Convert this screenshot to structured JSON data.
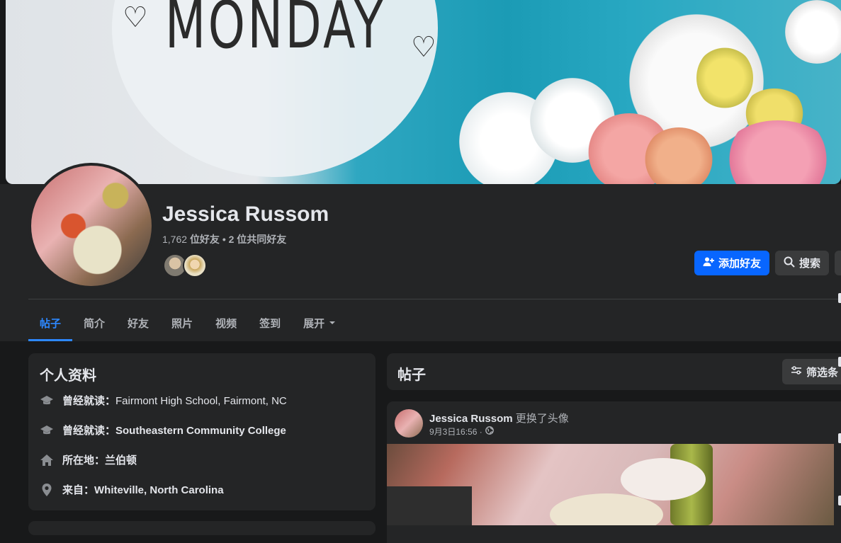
{
  "cover": {
    "text": "MONDAY"
  },
  "profile": {
    "name": "Jessica Russom",
    "friends_count": "1,762",
    "friends_suffix": "位好友",
    "mutual_text": "• 2 位共同好友"
  },
  "actions": {
    "add_friend": "添加好友",
    "search": "搜索"
  },
  "tabs": [
    {
      "label": "帖子"
    },
    {
      "label": "简介"
    },
    {
      "label": "好友"
    },
    {
      "label": "照片"
    },
    {
      "label": "视频"
    },
    {
      "label": "签到"
    },
    {
      "label": "展开"
    }
  ],
  "intro": {
    "title": "个人资料",
    "items": [
      {
        "prefix": "曾经就读：",
        "value": "Fairmont High School, Fairmont, NC",
        "icon": "graduation-cap-icon"
      },
      {
        "prefix": "曾经就读：",
        "value": "Southeastern Community College",
        "icon": "graduation-cap-icon"
      },
      {
        "prefix": "所在地：",
        "value": "兰伯顿",
        "icon": "home-icon"
      },
      {
        "prefix": "来自：",
        "value": "Whiteville, North Carolina",
        "icon": "location-pin-icon"
      }
    ]
  },
  "posts": {
    "title": "帖子",
    "filter_label": "筛选条"
  },
  "post": {
    "author": "Jessica Russom",
    "action": "更换了头像",
    "time": "9月3日16:56 ·"
  },
  "colors": {
    "accent": "#2d88ff",
    "primary_button": "#0866ff",
    "surface": "#242526",
    "background": "#18191a"
  }
}
